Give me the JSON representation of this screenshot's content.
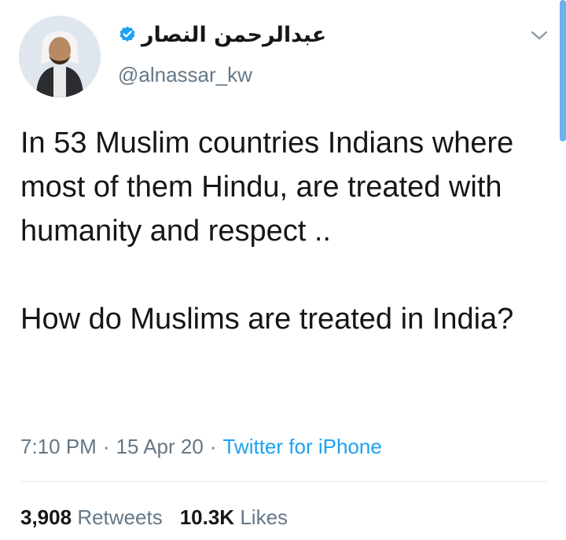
{
  "user": {
    "display_name": "عبدالرحمن النصار",
    "handle": "@alnassar_kw",
    "verified": true
  },
  "tweet": {
    "paragraphs": [
      "In 53 Muslim countries Indians where most of them Hindu, are treated with humanity and respect ..",
      "How do Muslims are treated in India?"
    ],
    "time": "7:10 PM",
    "dot": "·",
    "date": "15 Apr 20",
    "source": "Twitter for iPhone"
  },
  "stats": {
    "retweets_count": "3,908",
    "retweets_label": "Retweets",
    "likes_count": "10.3K",
    "likes_label": "Likes"
  },
  "colors": {
    "verified": "#1da1f2",
    "link": "#1da1f2",
    "secondary_text": "#657786",
    "primary_text": "#14171a",
    "scroll_accent": "#6fb0ef"
  },
  "icons": {
    "verified": "verified-badge-icon",
    "menu": "chevron-down-icon"
  }
}
